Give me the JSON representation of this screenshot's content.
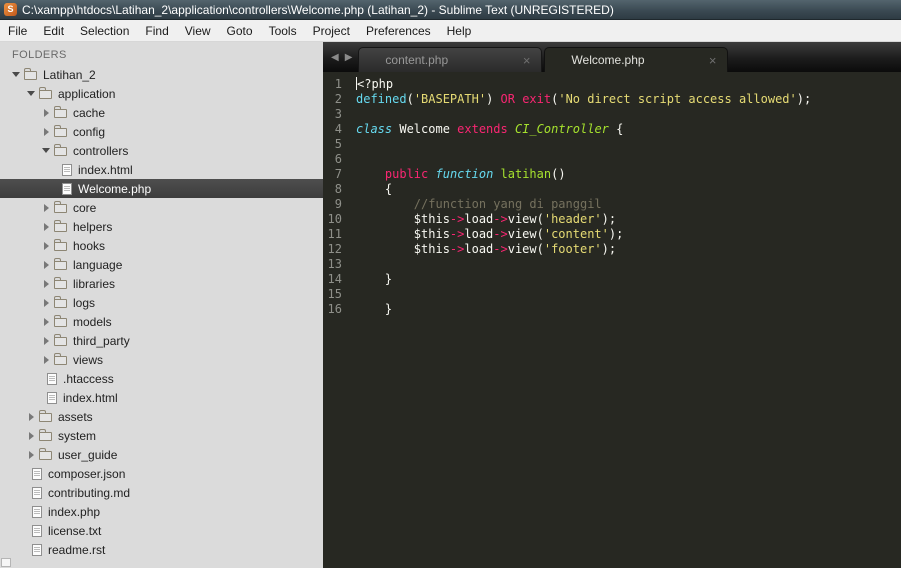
{
  "window": {
    "title": "C:\\xampp\\htdocs\\Latihan_2\\application\\controllers\\Welcome.php (Latihan_2) - Sublime Text (UNREGISTERED)",
    "app_initial": "S"
  },
  "menu": {
    "items": [
      "File",
      "Edit",
      "Selection",
      "Find",
      "View",
      "Goto",
      "Tools",
      "Project",
      "Preferences",
      "Help"
    ]
  },
  "sidebar": {
    "header": "FOLDERS",
    "items": [
      {
        "label": "Latihan_2",
        "kind": "folder",
        "expanded": true,
        "indent": 0,
        "selected": false
      },
      {
        "label": "application",
        "kind": "folder",
        "expanded": true,
        "indent": 1,
        "selected": false
      },
      {
        "label": "cache",
        "kind": "folder",
        "expanded": false,
        "indent": 2,
        "selected": false
      },
      {
        "label": "config",
        "kind": "folder",
        "expanded": false,
        "indent": 2,
        "selected": false
      },
      {
        "label": "controllers",
        "kind": "folder",
        "expanded": true,
        "indent": 2,
        "selected": false
      },
      {
        "label": "index.html",
        "kind": "file",
        "indent": 3,
        "selected": false
      },
      {
        "label": "Welcome.php",
        "kind": "file",
        "indent": 3,
        "selected": true
      },
      {
        "label": "core",
        "kind": "folder",
        "expanded": false,
        "indent": 2,
        "selected": false
      },
      {
        "label": "helpers",
        "kind": "folder",
        "expanded": false,
        "indent": 2,
        "selected": false
      },
      {
        "label": "hooks",
        "kind": "folder",
        "expanded": false,
        "indent": 2,
        "selected": false
      },
      {
        "label": "language",
        "kind": "folder",
        "expanded": false,
        "indent": 2,
        "selected": false
      },
      {
        "label": "libraries",
        "kind": "folder",
        "expanded": false,
        "indent": 2,
        "selected": false
      },
      {
        "label": "logs",
        "kind": "folder",
        "expanded": false,
        "indent": 2,
        "selected": false
      },
      {
        "label": "models",
        "kind": "folder",
        "expanded": false,
        "indent": 2,
        "selected": false
      },
      {
        "label": "third_party",
        "kind": "folder",
        "expanded": false,
        "indent": 2,
        "selected": false
      },
      {
        "label": "views",
        "kind": "folder",
        "expanded": false,
        "indent": 2,
        "selected": false
      },
      {
        "label": ".htaccess",
        "kind": "file",
        "indent": 2,
        "selected": false
      },
      {
        "label": "index.html",
        "kind": "file",
        "indent": 2,
        "selected": false
      },
      {
        "label": "assets",
        "kind": "folder",
        "expanded": false,
        "indent": 1,
        "selected": false
      },
      {
        "label": "system",
        "kind": "folder",
        "expanded": false,
        "indent": 1,
        "selected": false
      },
      {
        "label": "user_guide",
        "kind": "folder",
        "expanded": false,
        "indent": 1,
        "selected": false
      },
      {
        "label": "composer.json",
        "kind": "file",
        "indent": 1,
        "selected": false
      },
      {
        "label": "contributing.md",
        "kind": "file",
        "indent": 1,
        "selected": false
      },
      {
        "label": "index.php",
        "kind": "file",
        "indent": 1,
        "selected": false
      },
      {
        "label": "license.txt",
        "kind": "file",
        "indent": 1,
        "selected": false
      },
      {
        "label": "readme.rst",
        "kind": "file",
        "indent": 1,
        "selected": false
      }
    ]
  },
  "tabs": {
    "back_glyph": "◀",
    "forward_glyph": "▶",
    "close_glyph": "×",
    "items": [
      {
        "label": "content.php",
        "active": false
      },
      {
        "label": "Welcome.php",
        "active": true
      }
    ]
  },
  "editor": {
    "lines": [
      {
        "n": 1,
        "cursor": true,
        "tokens": [
          [
            "plain",
            "<?php"
          ]
        ]
      },
      {
        "n": 2,
        "tokens": [
          [
            "blue",
            "defined"
          ],
          [
            "plain",
            "("
          ],
          [
            "yellow",
            "'BASEPATH'"
          ],
          [
            "plain",
            ") "
          ],
          [
            "pink",
            "OR"
          ],
          [
            "plain",
            " "
          ],
          [
            "pink",
            "exit"
          ],
          [
            "plain",
            "("
          ],
          [
            "yellow",
            "'No direct script access allowed'"
          ],
          [
            "plain",
            ");"
          ]
        ]
      },
      {
        "n": 3,
        "tokens": []
      },
      {
        "n": 4,
        "tokens": [
          [
            "blue-italic",
            "class"
          ],
          [
            "plain",
            " Welcome "
          ],
          [
            "pink",
            "extends"
          ],
          [
            "plain",
            " "
          ],
          [
            "green-italic",
            "CI_Controller"
          ],
          [
            "plain",
            " {"
          ]
        ]
      },
      {
        "n": 5,
        "tokens": []
      },
      {
        "n": 6,
        "tokens": []
      },
      {
        "n": 7,
        "tokens": [
          [
            "plain",
            "    "
          ],
          [
            "pink",
            "public"
          ],
          [
            "plain",
            " "
          ],
          [
            "blue-italic",
            "function"
          ],
          [
            "plain",
            " "
          ],
          [
            "green",
            "latihan"
          ],
          [
            "plain",
            "()"
          ]
        ]
      },
      {
        "n": 8,
        "tokens": [
          [
            "plain",
            "    {"
          ]
        ]
      },
      {
        "n": 9,
        "tokens": [
          [
            "comment",
            "        //function yang di panggil"
          ]
        ]
      },
      {
        "n": 10,
        "tokens": [
          [
            "plain",
            "        $this"
          ],
          [
            "pink",
            "->"
          ],
          [
            "plain",
            "load"
          ],
          [
            "pink",
            "->"
          ],
          [
            "plain",
            "view("
          ],
          [
            "yellow",
            "'header'"
          ],
          [
            "plain",
            ");"
          ]
        ]
      },
      {
        "n": 11,
        "tokens": [
          [
            "plain",
            "        $this"
          ],
          [
            "pink",
            "->"
          ],
          [
            "plain",
            "load"
          ],
          [
            "pink",
            "->"
          ],
          [
            "plain",
            "view("
          ],
          [
            "yellow",
            "'content'"
          ],
          [
            "plain",
            ");"
          ]
        ]
      },
      {
        "n": 12,
        "tokens": [
          [
            "plain",
            "        $this"
          ],
          [
            "pink",
            "->"
          ],
          [
            "plain",
            "load"
          ],
          [
            "pink",
            "->"
          ],
          [
            "plain",
            "view("
          ],
          [
            "yellow",
            "'footer'"
          ],
          [
            "plain",
            ");"
          ]
        ]
      },
      {
        "n": 13,
        "tokens": []
      },
      {
        "n": 14,
        "tokens": [
          [
            "plain",
            "    }"
          ]
        ]
      },
      {
        "n": 15,
        "tokens": []
      },
      {
        "n": 16,
        "tokens": [
          [
            "plain",
            "    }"
          ]
        ]
      }
    ]
  },
  "colors": {
    "editor_bg": "#272822",
    "sidebar_bg": "#dbdbdb",
    "selection_bg": "#444444",
    "keyword_pink": "#f92672",
    "builtin_blue": "#66d9ef",
    "string_yellow": "#e6db74",
    "name_green": "#a6e22e",
    "comment_gray": "#75715e",
    "line_number_gray": "#8f908a"
  }
}
